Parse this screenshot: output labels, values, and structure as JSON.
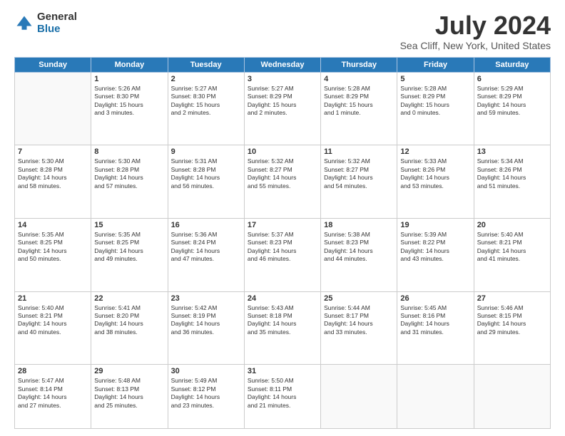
{
  "logo": {
    "general": "General",
    "blue": "Blue"
  },
  "title": "July 2024",
  "subtitle": "Sea Cliff, New York, United States",
  "weekdays": [
    "Sunday",
    "Monday",
    "Tuesday",
    "Wednesday",
    "Thursday",
    "Friday",
    "Saturday"
  ],
  "weeks": [
    [
      {
        "day": "",
        "info": ""
      },
      {
        "day": "1",
        "info": "Sunrise: 5:26 AM\nSunset: 8:30 PM\nDaylight: 15 hours\nand 3 minutes."
      },
      {
        "day": "2",
        "info": "Sunrise: 5:27 AM\nSunset: 8:30 PM\nDaylight: 15 hours\nand 2 minutes."
      },
      {
        "day": "3",
        "info": "Sunrise: 5:27 AM\nSunset: 8:29 PM\nDaylight: 15 hours\nand 2 minutes."
      },
      {
        "day": "4",
        "info": "Sunrise: 5:28 AM\nSunset: 8:29 PM\nDaylight: 15 hours\nand 1 minute."
      },
      {
        "day": "5",
        "info": "Sunrise: 5:28 AM\nSunset: 8:29 PM\nDaylight: 15 hours\nand 0 minutes."
      },
      {
        "day": "6",
        "info": "Sunrise: 5:29 AM\nSunset: 8:29 PM\nDaylight: 14 hours\nand 59 minutes."
      }
    ],
    [
      {
        "day": "7",
        "info": "Sunrise: 5:30 AM\nSunset: 8:28 PM\nDaylight: 14 hours\nand 58 minutes."
      },
      {
        "day": "8",
        "info": "Sunrise: 5:30 AM\nSunset: 8:28 PM\nDaylight: 14 hours\nand 57 minutes."
      },
      {
        "day": "9",
        "info": "Sunrise: 5:31 AM\nSunset: 8:28 PM\nDaylight: 14 hours\nand 56 minutes."
      },
      {
        "day": "10",
        "info": "Sunrise: 5:32 AM\nSunset: 8:27 PM\nDaylight: 14 hours\nand 55 minutes."
      },
      {
        "day": "11",
        "info": "Sunrise: 5:32 AM\nSunset: 8:27 PM\nDaylight: 14 hours\nand 54 minutes."
      },
      {
        "day": "12",
        "info": "Sunrise: 5:33 AM\nSunset: 8:26 PM\nDaylight: 14 hours\nand 53 minutes."
      },
      {
        "day": "13",
        "info": "Sunrise: 5:34 AM\nSunset: 8:26 PM\nDaylight: 14 hours\nand 51 minutes."
      }
    ],
    [
      {
        "day": "14",
        "info": "Sunrise: 5:35 AM\nSunset: 8:25 PM\nDaylight: 14 hours\nand 50 minutes."
      },
      {
        "day": "15",
        "info": "Sunrise: 5:35 AM\nSunset: 8:25 PM\nDaylight: 14 hours\nand 49 minutes."
      },
      {
        "day": "16",
        "info": "Sunrise: 5:36 AM\nSunset: 8:24 PM\nDaylight: 14 hours\nand 47 minutes."
      },
      {
        "day": "17",
        "info": "Sunrise: 5:37 AM\nSunset: 8:23 PM\nDaylight: 14 hours\nand 46 minutes."
      },
      {
        "day": "18",
        "info": "Sunrise: 5:38 AM\nSunset: 8:23 PM\nDaylight: 14 hours\nand 44 minutes."
      },
      {
        "day": "19",
        "info": "Sunrise: 5:39 AM\nSunset: 8:22 PM\nDaylight: 14 hours\nand 43 minutes."
      },
      {
        "day": "20",
        "info": "Sunrise: 5:40 AM\nSunset: 8:21 PM\nDaylight: 14 hours\nand 41 minutes."
      }
    ],
    [
      {
        "day": "21",
        "info": "Sunrise: 5:40 AM\nSunset: 8:21 PM\nDaylight: 14 hours\nand 40 minutes."
      },
      {
        "day": "22",
        "info": "Sunrise: 5:41 AM\nSunset: 8:20 PM\nDaylight: 14 hours\nand 38 minutes."
      },
      {
        "day": "23",
        "info": "Sunrise: 5:42 AM\nSunset: 8:19 PM\nDaylight: 14 hours\nand 36 minutes."
      },
      {
        "day": "24",
        "info": "Sunrise: 5:43 AM\nSunset: 8:18 PM\nDaylight: 14 hours\nand 35 minutes."
      },
      {
        "day": "25",
        "info": "Sunrise: 5:44 AM\nSunset: 8:17 PM\nDaylight: 14 hours\nand 33 minutes."
      },
      {
        "day": "26",
        "info": "Sunrise: 5:45 AM\nSunset: 8:16 PM\nDaylight: 14 hours\nand 31 minutes."
      },
      {
        "day": "27",
        "info": "Sunrise: 5:46 AM\nSunset: 8:15 PM\nDaylight: 14 hours\nand 29 minutes."
      }
    ],
    [
      {
        "day": "28",
        "info": "Sunrise: 5:47 AM\nSunset: 8:14 PM\nDaylight: 14 hours\nand 27 minutes."
      },
      {
        "day": "29",
        "info": "Sunrise: 5:48 AM\nSunset: 8:13 PM\nDaylight: 14 hours\nand 25 minutes."
      },
      {
        "day": "30",
        "info": "Sunrise: 5:49 AM\nSunset: 8:12 PM\nDaylight: 14 hours\nand 23 minutes."
      },
      {
        "day": "31",
        "info": "Sunrise: 5:50 AM\nSunset: 8:11 PM\nDaylight: 14 hours\nand 21 minutes."
      },
      {
        "day": "",
        "info": ""
      },
      {
        "day": "",
        "info": ""
      },
      {
        "day": "",
        "info": ""
      }
    ]
  ]
}
